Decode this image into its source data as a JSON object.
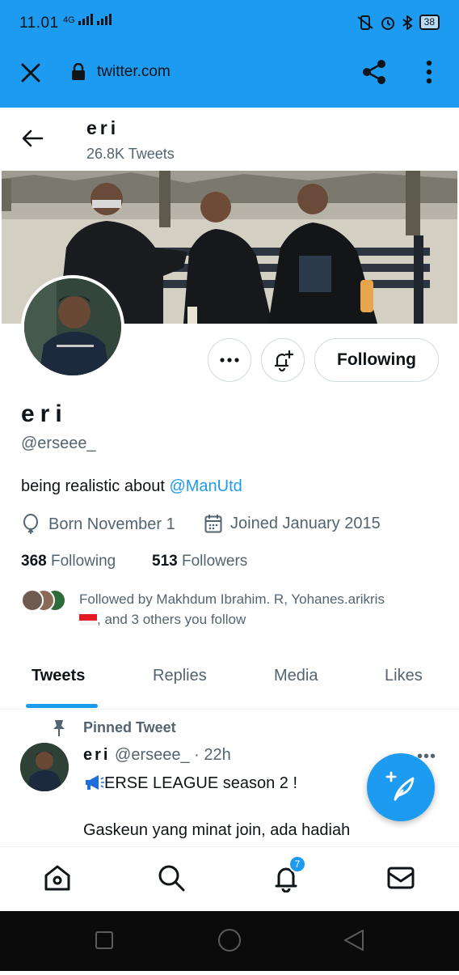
{
  "status_bar": {
    "time": "11.01",
    "network": "4G",
    "battery": "38"
  },
  "browser": {
    "url": "twitter.com"
  },
  "header": {
    "name": "eri",
    "tweet_count": "26.8K Tweets"
  },
  "profile": {
    "name": "eri",
    "handle": "@erseee_",
    "bio_text": "being realistic about ",
    "bio_mention": "@ManUtd",
    "born": "Born November 1",
    "joined": "Joined January 2015",
    "following_count": "368",
    "following_label": "Following",
    "followers_count": "513",
    "followers_label": "Followers",
    "followed_by_text": "Followed by Makhdum Ibrahim. R, Yohanes.arikris",
    "followed_by_more": ", and 3 others you follow"
  },
  "actions": {
    "following_button": "Following"
  },
  "tabs": [
    {
      "label": "Tweets"
    },
    {
      "label": "Replies"
    },
    {
      "label": "Media"
    },
    {
      "label": "Likes"
    }
  ],
  "pinned_tweet": {
    "pinned_label": "Pinned Tweet",
    "author": "eri",
    "handle_time": " @erseee_ · 22h",
    "line1": "ERSE LEAGUE season 2 !",
    "line2": "Gaskeun yang minat join, ada hadiah"
  },
  "bottom_nav": {
    "notification_badge": "7"
  },
  "colors": {
    "accent": "#1d9bf0",
    "secondary_text": "#536471",
    "primary_text": "#0f1419"
  },
  "icons": [
    "close-icon",
    "lock-icon",
    "share-icon",
    "more-vertical-icon",
    "back-arrow-icon",
    "more-horizontal-icon",
    "bell-plus-icon",
    "balloon-icon",
    "calendar-icon",
    "pin-icon",
    "compose-icon",
    "home-icon",
    "search-icon",
    "bell-icon",
    "mail-icon"
  ]
}
